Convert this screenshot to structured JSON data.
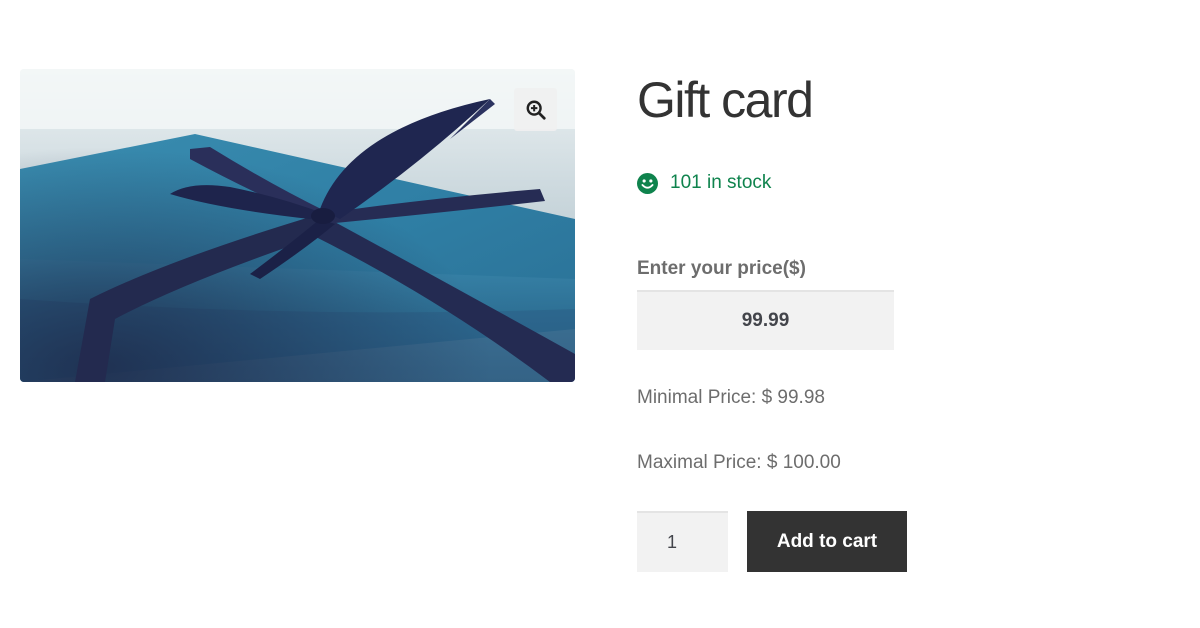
{
  "product": {
    "title": "Gift card",
    "image_alt": "Gift card",
    "image_icon": "zoom-in-icon"
  },
  "stock": {
    "text": "101 in stock",
    "icon": "smiley-icon",
    "color": "#0f834d"
  },
  "price_field": {
    "label": "Enter your price($)",
    "value": "99.99"
  },
  "limits": {
    "min": "Minimal Price: $ 99.98",
    "max": "Maximal Price: $ 100.00"
  },
  "cart": {
    "quantity": "1",
    "button_label": "Add to cart",
    "button_color": "#333333"
  }
}
